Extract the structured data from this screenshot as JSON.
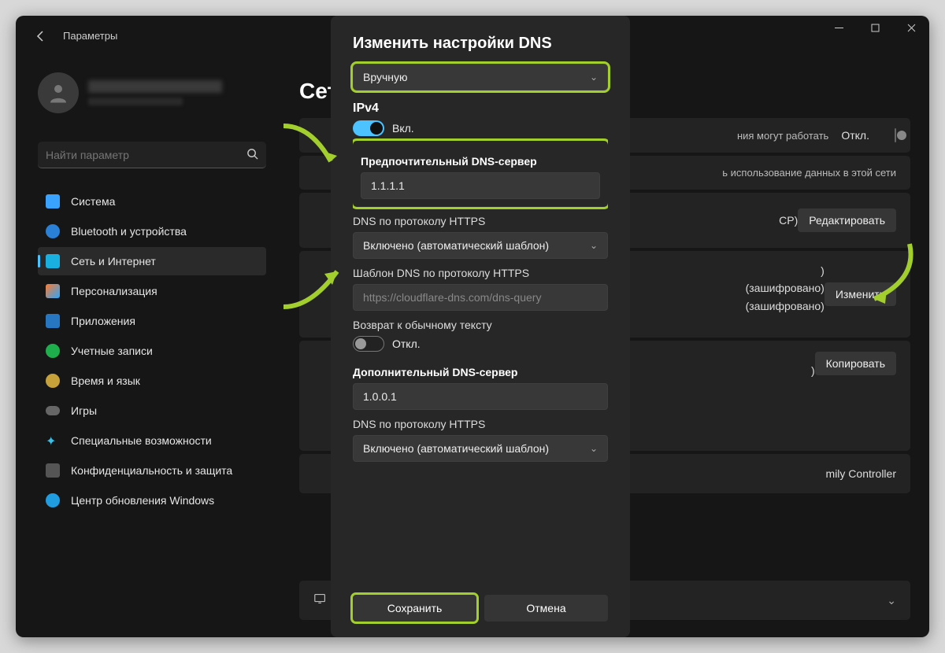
{
  "app": {
    "title": "Параметры"
  },
  "search": {
    "placeholder": "Найти параметр"
  },
  "nav": {
    "items": [
      {
        "label": "Система"
      },
      {
        "label": "Bluetooth и устройства"
      },
      {
        "label": "Сеть и Интернет"
      },
      {
        "label": "Персонализация"
      },
      {
        "label": "Приложения"
      },
      {
        "label": "Учетные записи"
      },
      {
        "label": "Время и язык"
      },
      {
        "label": "Игры"
      },
      {
        "label": "Специальные возможности"
      },
      {
        "label": "Конфиденциальность и защита"
      },
      {
        "label": "Центр обновления Windows"
      }
    ]
  },
  "page": {
    "title": "Сет"
  },
  "rows": {
    "metered": {
      "text": "ния могут работать",
      "state": "Откл."
    },
    "datalimit": {
      "text": "ь использование данных в этой сети"
    },
    "ip": {
      "text": "CP)",
      "btn": "Редактировать"
    },
    "dns": {
      "line2": ")",
      "line3": "(зашифровано)",
      "line4": "(зашифровано)",
      "btn": "Изменить"
    },
    "copy": {
      "btn": "Копировать",
      "line": ")"
    },
    "controller": {
      "text": "mily Controller"
    }
  },
  "dialog": {
    "title": "Изменить настройки DNS",
    "mode": "Вручную",
    "ipv4": "IPv4",
    "ipv4_toggle": "Вкл.",
    "preferred_label": "Предпочтительный DNS-сервер",
    "preferred_value": "1.1.1.1",
    "doh_label": "DNS по протоколу HTTPS",
    "doh_value": "Включено (автоматический шаблон)",
    "template_label": "Шаблон DNS по протоколу HTTPS",
    "template_value": "https://cloudflare-dns.com/dns-query",
    "fallback_label": "Возврат к обычному тексту",
    "fallback_toggle": "Откл.",
    "alt_label": "Дополнительный DNS-сервер",
    "alt_value": "1.0.0.1",
    "doh2_label": "DNS по протоколу HTTPS",
    "doh2_value": "Включено (автоматический шаблон)",
    "save": "Сохранить",
    "cancel": "Отмена"
  },
  "colors": {
    "highlight": "#a3cf2e",
    "accent": "#4cc2ff"
  }
}
